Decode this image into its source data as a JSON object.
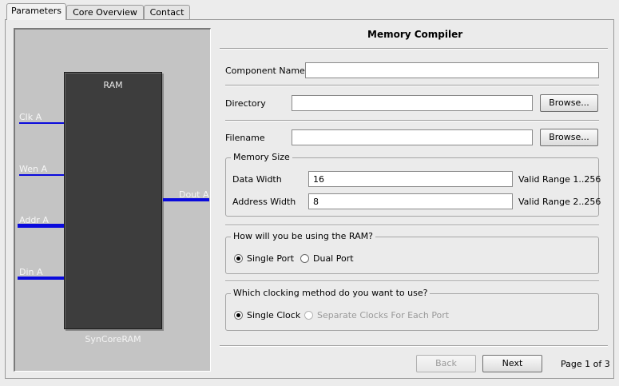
{
  "tabs": [
    {
      "label": "Parameters",
      "active": true
    },
    {
      "label": "Core Overview",
      "active": false
    },
    {
      "label": "Contact",
      "active": false
    }
  ],
  "diagram": {
    "chip_title": "RAM",
    "chip_name": "SynCoreRAM",
    "pins": {
      "clk": "Clk A",
      "wen": "Wen A",
      "addr": "Addr A",
      "din": "Din A",
      "dout": "Dout A"
    },
    "colors": {
      "chip": "#3d3d3d",
      "wire": "#0a0adc",
      "background": "#c4c4c4"
    }
  },
  "form": {
    "title": "Memory Compiler",
    "component_name": {
      "label": "Component Name",
      "value": ""
    },
    "directory": {
      "label": "Directory",
      "value": "",
      "browse_label": "Browse..."
    },
    "filename": {
      "label": "Filename",
      "value": "",
      "browse_label": "Browse..."
    },
    "memory_size": {
      "title": "Memory Size",
      "data_width": {
        "label": "Data Width",
        "value": "16",
        "range": "Valid Range 1..256"
      },
      "address_width": {
        "label": "Address Width",
        "value": "8",
        "range": "Valid Range 2..256"
      }
    },
    "ram_usage": {
      "title": "How will you be using the RAM?",
      "options": [
        {
          "label": "Single Port",
          "selected": true
        },
        {
          "label": "Dual Port",
          "selected": false
        }
      ]
    },
    "clocking": {
      "title": "Which clocking method do you want to use?",
      "options": [
        {
          "label": "Single Clock",
          "selected": true,
          "enabled": true
        },
        {
          "label": "Separate Clocks For Each Port",
          "selected": false,
          "enabled": false
        }
      ]
    }
  },
  "footer": {
    "back_label": "Back",
    "next_label": "Next",
    "page_indicator": "Page 1 of 3"
  }
}
